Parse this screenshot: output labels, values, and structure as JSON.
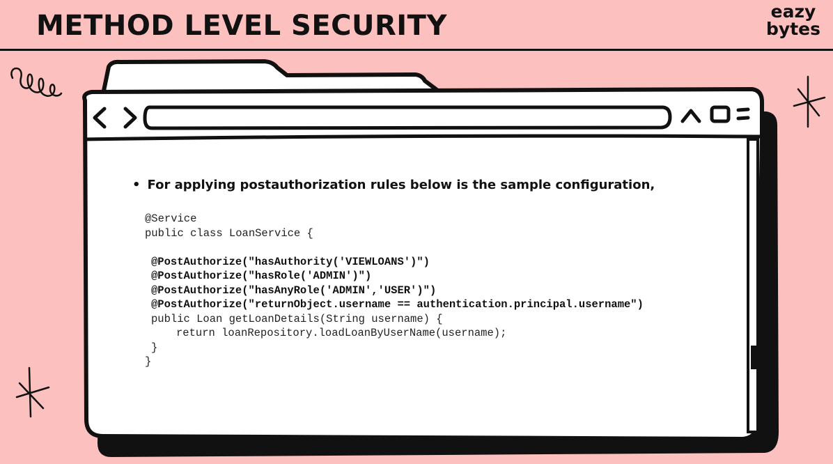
{
  "header": {
    "title": "METHOD LEVEL SECURITY",
    "logo_line1": "eazy",
    "logo_line2": "bytes"
  },
  "browser_icons": [
    "chevron-left-icon",
    "chevron-right-icon",
    "chevron-up-icon",
    "square-icon",
    "menu-icon"
  ],
  "content": {
    "bullet": "For applying postauthorization rules below is the sample configuration,",
    "code_lines": [
      {
        "text": "@Service",
        "bold": false,
        "indent": 0
      },
      {
        "text": "public class LoanService {",
        "bold": false,
        "indent": 0
      },
      {
        "text": "",
        "bold": false,
        "indent": 0
      },
      {
        "text": "@PostAuthorize(\"hasAuthority('VIEWLOANS')\")",
        "bold": true,
        "indent": 1
      },
      {
        "text": "@PostAuthorize(\"hasRole('ADMIN')\")",
        "bold": true,
        "indent": 1
      },
      {
        "text": "@PostAuthorize(\"hasAnyRole('ADMIN','USER')\")",
        "bold": true,
        "indent": 1
      },
      {
        "text": "@PostAuthorize(\"returnObject.username == authentication.principal.username\")",
        "bold": true,
        "indent": 1
      },
      {
        "text": "public Loan getLoanDetails(String username) {",
        "bold": false,
        "indent": 1
      },
      {
        "text": "return loanRepository.loadLoanByUserName(username);",
        "bold": false,
        "indent": 5
      },
      {
        "text": "}",
        "bold": false,
        "indent": 1
      },
      {
        "text": "}",
        "bold": false,
        "indent": 0
      }
    ]
  },
  "colors": {
    "background": "#fcc1be",
    "ink": "#111111",
    "window": "#ffffff"
  }
}
